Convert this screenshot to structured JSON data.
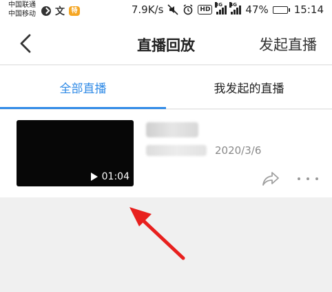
{
  "status_bar": {
    "carrier_1": "中国联通",
    "carrier_2": "中国移动",
    "sale_badge": "特",
    "wen_glyph": "文",
    "speed": "7.9K/s",
    "hd": "HD",
    "net_3g": "3G",
    "net_4g": "4G",
    "battery_percent": "47%",
    "battery_level": 0.47,
    "time": "15:14"
  },
  "nav": {
    "title": "直播回放",
    "start_live": "发起直播"
  },
  "tabs": [
    {
      "label": "全部直播",
      "active": true
    },
    {
      "label": "我发起的直播",
      "active": false
    }
  ],
  "list": {
    "items": [
      {
        "duration": "01:04",
        "date": "2020/3/6"
      }
    ]
  },
  "colors": {
    "accent": "#2f8ae6",
    "annotation": "#e8201e"
  }
}
